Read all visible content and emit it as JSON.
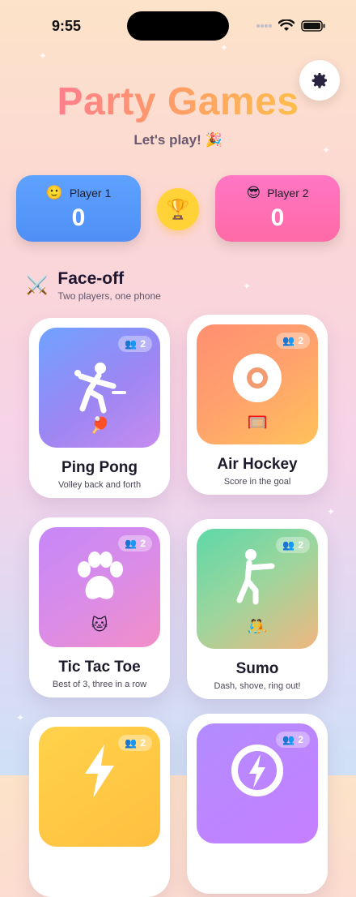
{
  "status": {
    "time": "9:55"
  },
  "header": {
    "title": "Party Games",
    "subtitle": "Let's play! 🎉"
  },
  "scores": [
    {
      "emoji": "🙂",
      "name": "Player 1",
      "value": "0",
      "color": "#5ea2ff"
    },
    {
      "emoji": "😎",
      "name": "Player 2",
      "value": "0",
      "color": "#ff6fb6"
    }
  ],
  "trophy": "🏆",
  "section": {
    "icon": "⚔️",
    "title": "Face-off",
    "subtitle": "Two players, one phone"
  },
  "games": [
    {
      "name": "Ping Pong",
      "desc": "Volley back and forth",
      "players": "2",
      "mini": "🏓",
      "icon": "ping-pong-player-icon"
    },
    {
      "name": "Air Hockey",
      "desc": "Score in the goal",
      "players": "2",
      "mini": "🥅",
      "icon": "puck-icon"
    },
    {
      "name": "Tic Tac Toe",
      "desc": "Best of 3, three in a row",
      "players": "2",
      "mini": "🐱",
      "icon": "paw-icon"
    },
    {
      "name": "Sumo",
      "desc": "Dash, shove, ring out!",
      "players": "2",
      "mini": "🤼",
      "icon": "pushing-figure-icon"
    },
    {
      "players": "2",
      "icon": "lightning-icon"
    },
    {
      "players": "2",
      "icon": "power-ring-icon"
    }
  ]
}
